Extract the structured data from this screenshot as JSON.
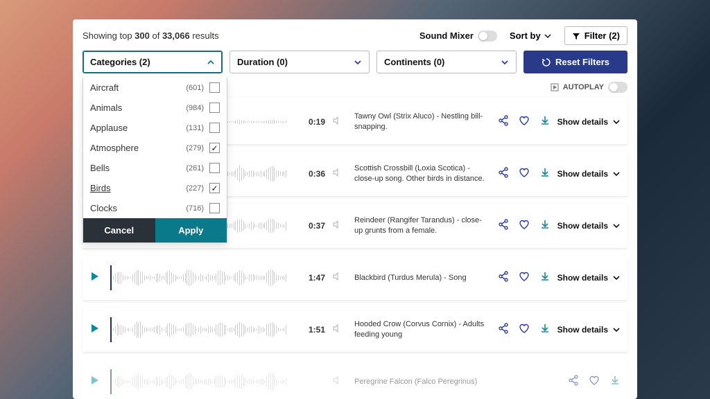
{
  "header": {
    "showing_prefix": "Showing top ",
    "showing_count": "300",
    "showing_mid": " of ",
    "showing_total": "33,066",
    "showing_suffix": " results",
    "sound_mixer": "Sound Mixer",
    "sort_by": "Sort by",
    "filter_label": "Filter (2)"
  },
  "filters": {
    "categories_label": "Categories (2)",
    "duration_label": "Duration (0)",
    "continents_label": "Continents (0)",
    "reset_label": "Reset Filters"
  },
  "autoplay": {
    "label": "AUTOPLAY"
  },
  "categories": [
    {
      "name": "Aircraft",
      "count": "(601)",
      "checked": false,
      "underline": false
    },
    {
      "name": "Animals",
      "count": "(984)",
      "checked": false,
      "underline": false
    },
    {
      "name": "Applause",
      "count": "(131)",
      "checked": false,
      "underline": false
    },
    {
      "name": "Atmosphere",
      "count": "(279)",
      "checked": true,
      "underline": false
    },
    {
      "name": "Bells",
      "count": "(261)",
      "checked": false,
      "underline": false
    },
    {
      "name": "Birds",
      "count": "(227)",
      "checked": true,
      "underline": true
    },
    {
      "name": "Clocks",
      "count": "(716)",
      "checked": false,
      "underline": false
    }
  ],
  "cat_actions": {
    "cancel": "Cancel",
    "apply": "Apply"
  },
  "sounds": [
    {
      "duration": "0:19",
      "desc": "Tawny Owl (Strix Aluco) - Nestling bill-snapping.",
      "details": "Show details"
    },
    {
      "duration": "0:36",
      "desc": "Scottish Crossbill (Loxia Scotica) - close-up song. Other birds in distance.",
      "details": "Show details"
    },
    {
      "duration": "0:37",
      "desc": "Reindeer (Rangifer Tarandus) - close-up grunts from a female.",
      "details": "Show details"
    },
    {
      "duration": "1:47",
      "desc": "Blackbird (Turdus Merula) - Song",
      "details": "Show details"
    },
    {
      "duration": "1:51",
      "desc": "Hooded Crow (Corvus Cornix) - Adults feeding young",
      "details": "Show details"
    },
    {
      "duration": "",
      "desc": "Peregrine Falcon (Falco Peregrinus)",
      "details": ""
    }
  ]
}
